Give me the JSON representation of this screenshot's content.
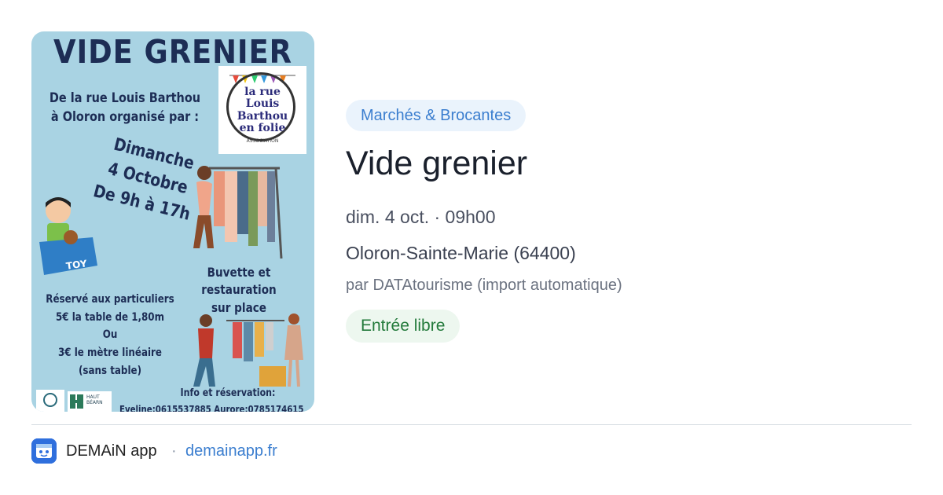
{
  "poster": {
    "title": "VIDE GRENIER",
    "organizer_line": "De la rue Louis Barthou\nà Oloron organisé par :",
    "date_text": "Dimanche\n4 Octobre\nDe 9h à 17h",
    "buvette": "Buvette et restauration\nsur place",
    "reserve": "Réservé aux particuliers\n5€ la table de 1,80m\nOu\n3€ le mètre linéaire\n(sans table)",
    "info": "Info et réservation:",
    "phones": "Eveline:0615537885   Aurore:0785174615",
    "logo_text": "la rue\nLouis\nBarthou\nen folie",
    "logo_sub": "ASSOCIATION",
    "toy_label": "TOY",
    "haut_bearn": "HAUT\nBÉARN"
  },
  "event": {
    "category": "Marchés & Brocantes",
    "title": "Vide grenier",
    "datetime": "dim. 4 oct. · 09h00",
    "location": "Oloron-Sainte-Marie (64400)",
    "source": "par DATAtourisme (import automatique)",
    "price": "Entrée libre"
  },
  "footer": {
    "app_name": "DEMAiN app",
    "separator": "·",
    "link": "demainapp.fr"
  },
  "colors": {
    "accent": "#3b7ecf",
    "tag_bg": "#eaf3fc",
    "price_bg": "#edf7ef",
    "price_text": "#237a3b",
    "poster_bg": "#a9d3e3"
  }
}
